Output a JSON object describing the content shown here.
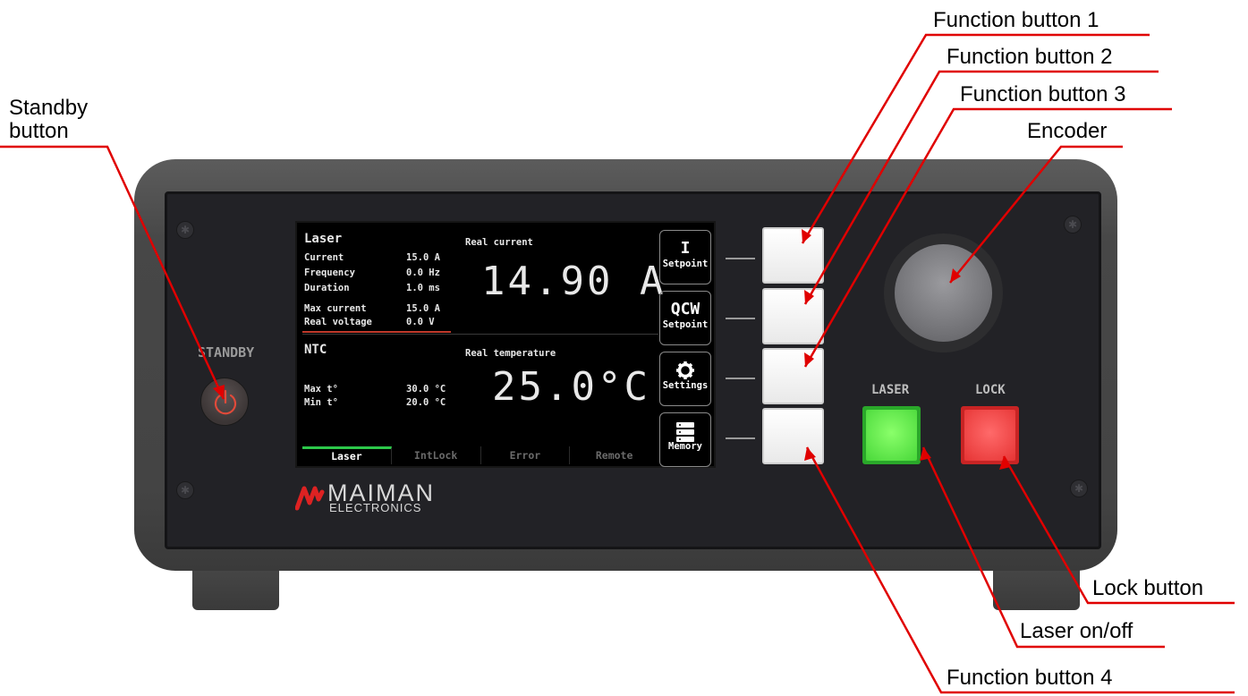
{
  "callouts": {
    "function_button_1": "Function button 1",
    "function_button_2": "Function button 2",
    "function_button_3": "Function button 3",
    "encoder": "Encoder",
    "standby_line1": "Standby",
    "standby_line2": "button",
    "lock_button": "Lock button",
    "laser_on_off": "Laser on/off",
    "function_button_4": "Function button 4"
  },
  "panel": {
    "standby_label": "STANDBY",
    "laser_label": "LASER",
    "lock_label": "LOCK",
    "logo_name": "MAIMAN",
    "logo_sub": "ELECTRONICS"
  },
  "screen": {
    "laser_heading": "Laser",
    "params": [
      {
        "label": "Current",
        "value": "15.0 A"
      },
      {
        "label": "Frequency",
        "value": "0.0 Hz"
      },
      {
        "label": "Duration",
        "value": "1.0 ms"
      },
      {
        "label": "Max  current",
        "value": "15.0 A"
      },
      {
        "label": "Real voltage",
        "value": "0.0 V"
      }
    ],
    "real_current_label": "Real current",
    "real_current_value": "14.90 A",
    "ntc_heading": "NTC",
    "ntc_params": [
      {
        "label": "Max t°",
        "value": "30.0 °C"
      },
      {
        "label": "Min t°",
        "value": "20.0 °C"
      }
    ],
    "real_temperature_label": "Real temperature",
    "real_temperature_value": "25.0°C",
    "tabs": [
      "Laser",
      "IntLock",
      "Error",
      "Remote"
    ],
    "active_tab": "Laser",
    "side_buttons": [
      {
        "symbol": "I",
        "label": "Setpoint"
      },
      {
        "symbol": "QCW",
        "label": "Setpoint"
      },
      {
        "symbol": "",
        "label": "Settings"
      },
      {
        "symbol": "",
        "label": "Memory"
      }
    ]
  },
  "colors": {
    "callout_line": "#e00000",
    "laser_button": "#49d83a",
    "lock_button": "#e63434",
    "active_tab_accent": "#2cc84a",
    "separator": "#c0392b"
  }
}
